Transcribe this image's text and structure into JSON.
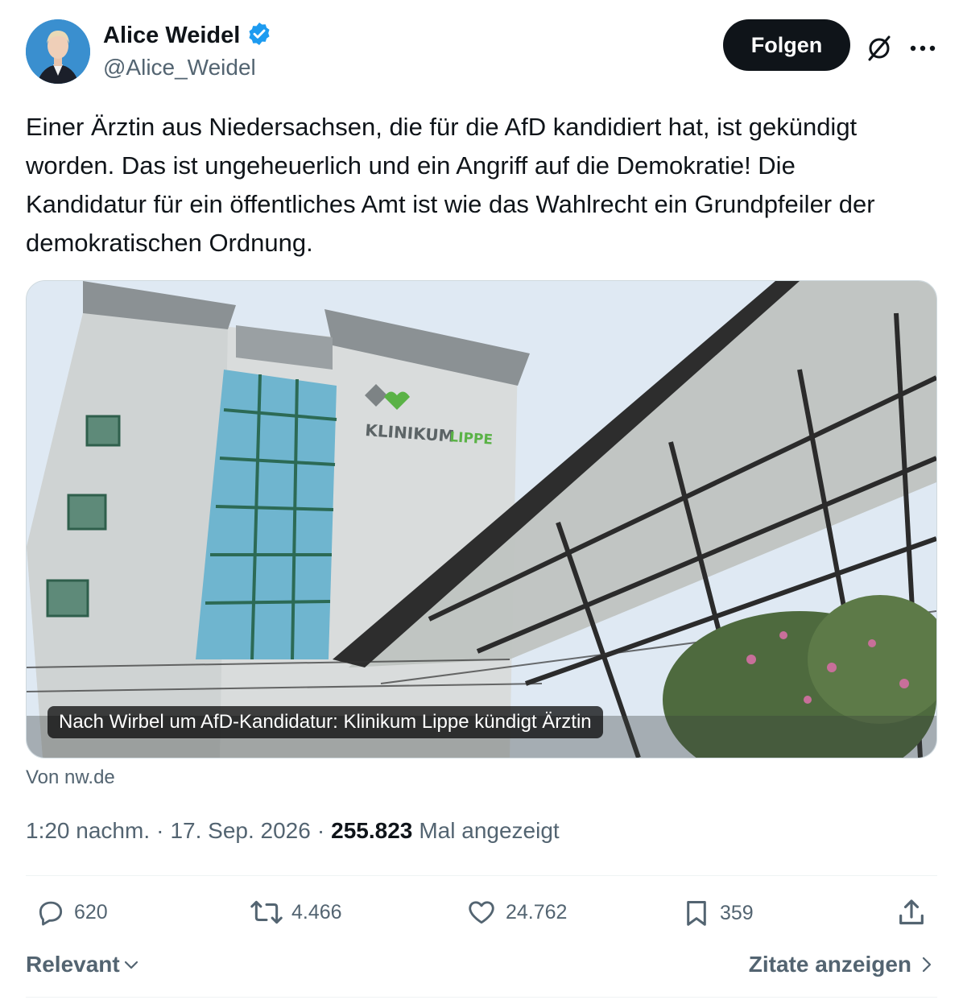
{
  "author": {
    "name": "Alice Weidel",
    "handle": "@Alice_Weidel",
    "verified": true,
    "verified_color": "#1d9bf0"
  },
  "header": {
    "follow_label": "Folgen",
    "grok_icon": "slashed-circle-icon",
    "more_icon": "more-dots-icon"
  },
  "tweet": {
    "text": "Einer Ärztin aus Niedersachsen, die für die AfD kandidiert hat, ist gekündigt worden. Das ist ungeheuerlich und ein Angriff auf die Demokratie! Die Kandidatur für ein öffentliches Amt ist wie das Wahlrecht ein Grundpfeiler der demokratischen Ordnung."
  },
  "card": {
    "caption": "Nach Wirbel um AfD-Kandidatur: Klinikum Lippe kündigt Ärztin",
    "building_sign": "KLINIKUM",
    "building_sign_accent": "LIPPE",
    "source": "Von nw.de"
  },
  "meta": {
    "time": "1:20 nachm.",
    "separator": "·",
    "date": "17. Sep. 2026",
    "views": "255.823",
    "views_label": "Mal angezeigt"
  },
  "actions": {
    "replies": "620",
    "reposts": "4.466",
    "likes": "24.762",
    "bookmarks": "359"
  },
  "footer": {
    "sort_label": "Relevant",
    "quotes_label": "Zitate anzeigen"
  },
  "colors": {
    "text_primary": "#0f1419",
    "text_secondary": "#536471",
    "accent": "#1d9bf0"
  }
}
